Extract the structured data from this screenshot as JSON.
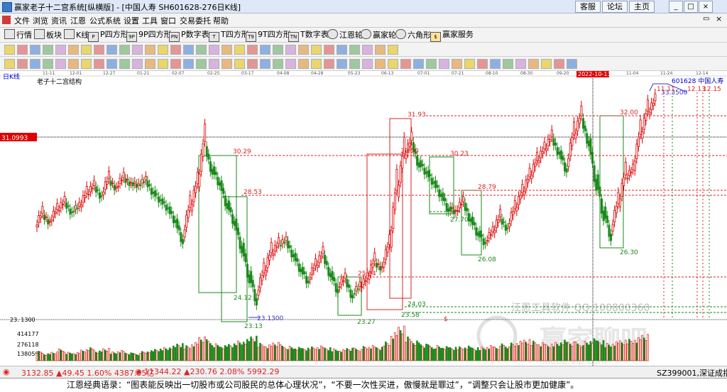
{
  "window": {
    "title": "赢家老子十二宫系统[纵横版] - [中国人寿  SH601628-276日K线]",
    "buttons": [
      "客服",
      "论坛",
      "主页"
    ]
  },
  "menu": [
    "文件",
    "浏览",
    "资讯",
    "江恩",
    "公式系统",
    "设置",
    "工具",
    "窗口",
    "交易委托",
    "帮助"
  ],
  "toolbar": {
    "items": [
      "行情",
      "板块",
      "K线",
      "P四方形",
      "9P四方形",
      "P数字表",
      "T四方形",
      "9T四方形",
      "T数字表",
      "江恩轮",
      "赢家轮",
      "六角形",
      "赢家服务"
    ]
  },
  "chart": {
    "period_label": "日K线",
    "indicator_title": "老子十二宫结构",
    "stock_label": "601628   中国人寿",
    "price_label": "31.0993",
    "cursor_date": "2022-10-13",
    "watermark_text": "江恩工具软件   QQ:100800360",
    "watermark_big": "赢家聊吧",
    "watermark_url": "liaoba.vip.com",
    "low_label": "23.1300",
    "marker": "$",
    "date_ticks": [
      "11-11",
      "12-01",
      "12-27",
      "01-21",
      "02-07",
      "02-25",
      "03-17",
      "04-08",
      "04-28",
      "05-23",
      "06-13",
      "07-01",
      "07-21",
      "08-10",
      "08-30",
      "09-20",
      "11-04",
      "11-24",
      "12-14"
    ],
    "price_annotations": [
      "30.29",
      "28.53",
      "24.12",
      "23.13",
      "23.1300",
      "25.04",
      "23.27",
      "31.93",
      "30.50",
      "24.03",
      "23.58",
      "30.23",
      "28.79",
      "27.70",
      "26.08",
      "32.00",
      "26.30",
      "33.3500",
      "11.11",
      "12.13",
      "12.15"
    ],
    "volume_axis": [
      "414177",
      "276118",
      "138059"
    ],
    "price_axis_low": "23. 1300"
  },
  "chart_data": {
    "type": "candlestick",
    "y_range": [
      22.2,
      34.2
    ],
    "candles": [
      {
        "o": 26.8,
        "h": 27.6,
        "l": 26.4,
        "c": 27.4
      },
      {
        "o": 27.4,
        "h": 27.9,
        "l": 27.0,
        "c": 27.1
      },
      {
        "o": 27.1,
        "h": 27.8,
        "l": 26.9,
        "c": 27.6
      },
      {
        "o": 27.6,
        "h": 28.2,
        "l": 27.3,
        "c": 28.0
      },
      {
        "o": 28.0,
        "h": 28.3,
        "l": 27.4,
        "c": 27.6
      },
      {
        "o": 27.6,
        "h": 28.0,
        "l": 27.2,
        "c": 27.8
      },
      {
        "o": 27.8,
        "h": 28.6,
        "l": 27.6,
        "c": 28.4
      },
      {
        "o": 28.4,
        "h": 29.0,
        "l": 28.0,
        "c": 28.8
      },
      {
        "o": 28.8,
        "h": 29.2,
        "l": 28.2,
        "c": 28.4
      },
      {
        "o": 28.4,
        "h": 29.3,
        "l": 28.2,
        "c": 29.1
      },
      {
        "o": 29.1,
        "h": 29.5,
        "l": 28.6,
        "c": 28.8
      },
      {
        "o": 28.8,
        "h": 29.4,
        "l": 28.5,
        "c": 29.2
      },
      {
        "o": 29.2,
        "h": 29.6,
        "l": 28.8,
        "c": 29.0
      },
      {
        "o": 29.0,
        "h": 29.4,
        "l": 28.6,
        "c": 28.9
      },
      {
        "o": 28.9,
        "h": 29.3,
        "l": 28.5,
        "c": 29.1
      },
      {
        "o": 29.1,
        "h": 29.4,
        "l": 28.4,
        "c": 28.6
      },
      {
        "o": 28.6,
        "h": 29.0,
        "l": 28.0,
        "c": 28.2
      },
      {
        "o": 28.2,
        "h": 28.7,
        "l": 27.6,
        "c": 27.8
      },
      {
        "o": 27.8,
        "h": 28.2,
        "l": 27.0,
        "c": 27.2
      },
      {
        "o": 27.2,
        "h": 27.6,
        "l": 26.0,
        "c": 26.3
      },
      {
        "o": 26.3,
        "h": 27.8,
        "l": 26.1,
        "c": 27.6
      },
      {
        "o": 27.6,
        "h": 29.2,
        "l": 27.4,
        "c": 28.8
      },
      {
        "o": 28.8,
        "h": 31.1,
        "l": 28.6,
        "c": 30.8
      },
      {
        "o": 30.8,
        "h": 31.0,
        "l": 29.6,
        "c": 29.8
      },
      {
        "o": 29.8,
        "h": 30.2,
        "l": 28.8,
        "c": 29.1
      },
      {
        "o": 29.1,
        "h": 29.4,
        "l": 27.9,
        "c": 28.1
      },
      {
        "o": 28.1,
        "h": 28.4,
        "l": 27.0,
        "c": 27.2
      },
      {
        "o": 27.2,
        "h": 27.5,
        "l": 25.8,
        "c": 26.0
      },
      {
        "o": 26.0,
        "h": 26.3,
        "l": 24.4,
        "c": 24.6
      },
      {
        "o": 24.6,
        "h": 25.0,
        "l": 23.1,
        "c": 23.4
      },
      {
        "o": 23.4,
        "h": 24.6,
        "l": 23.2,
        "c": 24.4
      },
      {
        "o": 24.4,
        "h": 25.6,
        "l": 24.2,
        "c": 25.4
      },
      {
        "o": 25.4,
        "h": 26.2,
        "l": 25.0,
        "c": 25.9
      },
      {
        "o": 25.9,
        "h": 26.4,
        "l": 25.4,
        "c": 26.1
      },
      {
        "o": 26.1,
        "h": 26.5,
        "l": 25.3,
        "c": 25.5
      },
      {
        "o": 25.5,
        "h": 25.9,
        "l": 24.6,
        "c": 24.8
      },
      {
        "o": 24.8,
        "h": 25.2,
        "l": 24.0,
        "c": 24.2
      },
      {
        "o": 24.2,
        "h": 25.0,
        "l": 23.9,
        "c": 24.8
      },
      {
        "o": 24.8,
        "h": 25.6,
        "l": 24.6,
        "c": 25.4
      },
      {
        "o": 25.4,
        "h": 25.8,
        "l": 24.4,
        "c": 24.6
      },
      {
        "o": 24.6,
        "h": 24.9,
        "l": 23.6,
        "c": 23.8
      },
      {
        "o": 23.8,
        "h": 24.4,
        "l": 23.3,
        "c": 24.2
      },
      {
        "o": 24.2,
        "h": 24.6,
        "l": 23.3,
        "c": 23.5
      },
      {
        "o": 23.5,
        "h": 24.0,
        "l": 23.2,
        "c": 23.8
      },
      {
        "o": 23.8,
        "h": 24.4,
        "l": 23.6,
        "c": 24.2
      },
      {
        "o": 24.2,
        "h": 25.2,
        "l": 24.0,
        "c": 25.0
      },
      {
        "o": 25.0,
        "h": 25.3,
        "l": 24.6,
        "c": 24.8
      },
      {
        "o": 24.8,
        "h": 26.0,
        "l": 24.7,
        "c": 25.8
      },
      {
        "o": 25.8,
        "h": 28.6,
        "l": 25.6,
        "c": 28.3
      },
      {
        "o": 28.3,
        "h": 30.6,
        "l": 28.0,
        "c": 30.2
      },
      {
        "o": 30.2,
        "h": 31.3,
        "l": 29.8,
        "c": 31.0
      },
      {
        "o": 31.0,
        "h": 31.3,
        "l": 29.9,
        "c": 30.1
      },
      {
        "o": 30.1,
        "h": 30.4,
        "l": 29.4,
        "c": 29.6
      },
      {
        "o": 29.6,
        "h": 30.0,
        "l": 28.9,
        "c": 29.1
      },
      {
        "o": 29.1,
        "h": 29.4,
        "l": 28.3,
        "c": 28.5
      },
      {
        "o": 28.5,
        "h": 28.8,
        "l": 27.6,
        "c": 27.8
      },
      {
        "o": 27.8,
        "h": 28.1,
        "l": 27.4,
        "c": 27.6
      },
      {
        "o": 27.6,
        "h": 28.3,
        "l": 27.5,
        "c": 28.0
      },
      {
        "o": 28.0,
        "h": 28.3,
        "l": 27.1,
        "c": 27.3
      },
      {
        "o": 27.3,
        "h": 27.6,
        "l": 26.4,
        "c": 26.6
      },
      {
        "o": 26.6,
        "h": 26.9,
        "l": 25.9,
        "c": 26.1
      },
      {
        "o": 26.1,
        "h": 26.7,
        "l": 25.9,
        "c": 26.5
      },
      {
        "o": 26.5,
        "h": 27.4,
        "l": 26.3,
        "c": 27.2
      },
      {
        "o": 27.2,
        "h": 27.6,
        "l": 26.6,
        "c": 26.8
      },
      {
        "o": 26.8,
        "h": 27.8,
        "l": 26.6,
        "c": 27.6
      },
      {
        "o": 27.6,
        "h": 28.6,
        "l": 27.4,
        "c": 28.4
      },
      {
        "o": 28.4,
        "h": 29.4,
        "l": 28.2,
        "c": 29.2
      },
      {
        "o": 29.2,
        "h": 30.2,
        "l": 29.0,
        "c": 30.0
      },
      {
        "o": 30.0,
        "h": 30.8,
        "l": 29.6,
        "c": 30.6
      },
      {
        "o": 30.6,
        "h": 31.4,
        "l": 30.4,
        "c": 31.2
      },
      {
        "o": 31.2,
        "h": 31.6,
        "l": 30.4,
        "c": 30.6
      },
      {
        "o": 30.6,
        "h": 31.0,
        "l": 29.6,
        "c": 29.8
      },
      {
        "o": 29.8,
        "h": 31.4,
        "l": 29.7,
        "c": 31.2
      },
      {
        "o": 31.2,
        "h": 32.4,
        "l": 31.0,
        "c": 32.2
      },
      {
        "o": 32.2,
        "h": 32.6,
        "l": 31.0,
        "c": 31.2
      },
      {
        "o": 31.2,
        "h": 31.4,
        "l": 29.2,
        "c": 29.4
      },
      {
        "o": 29.4,
        "h": 29.6,
        "l": 27.6,
        "c": 27.8
      },
      {
        "o": 27.8,
        "h": 28.0,
        "l": 26.3,
        "c": 26.6
      },
      {
        "o": 26.6,
        "h": 28.0,
        "l": 26.4,
        "c": 27.8
      },
      {
        "o": 27.8,
        "h": 29.4,
        "l": 27.6,
        "c": 29.2
      },
      {
        "o": 29.2,
        "h": 30.0,
        "l": 28.8,
        "c": 29.6
      },
      {
        "o": 29.6,
        "h": 31.4,
        "l": 29.4,
        "c": 31.2
      },
      {
        "o": 31.2,
        "h": 32.6,
        "l": 31.0,
        "c": 32.4
      },
      {
        "o": 32.4,
        "h": 33.4,
        "l": 32.2,
        "c": 33.3
      }
    ],
    "volumes": [
      120,
      90,
      110,
      140,
      100,
      95,
      130,
      160,
      120,
      150,
      110,
      130,
      100,
      90,
      110,
      120,
      140,
      160,
      180,
      210,
      190,
      230,
      300,
      250,
      200,
      180,
      200,
      240,
      260,
      300,
      220,
      200,
      230,
      190,
      170,
      160,
      150,
      170,
      180,
      160,
      150,
      140,
      160,
      150,
      170,
      180,
      160,
      230,
      340,
      420,
      300,
      250,
      210,
      190,
      180,
      170,
      160,
      170,
      180,
      160,
      170,
      190,
      180,
      200,
      210,
      230,
      250,
      240,
      220,
      200,
      230,
      260,
      240,
      220,
      230,
      260,
      240,
      210,
      230,
      250,
      270,
      290,
      330
    ]
  },
  "status": {
    "sh": "3132.85 ▲49.45 1.60% 4387.05亿",
    "sz": "11344.22 ▲230.76 2.08% 5992.29",
    "index": "SZ399001,深证成指"
  },
  "quote": "江恩经典语录：“图表能反映出一切股市或公司股民的总体心理状况”，“不要一次性买进，傲慢就是罪过”，“调整只会让股市更加健康”。"
}
